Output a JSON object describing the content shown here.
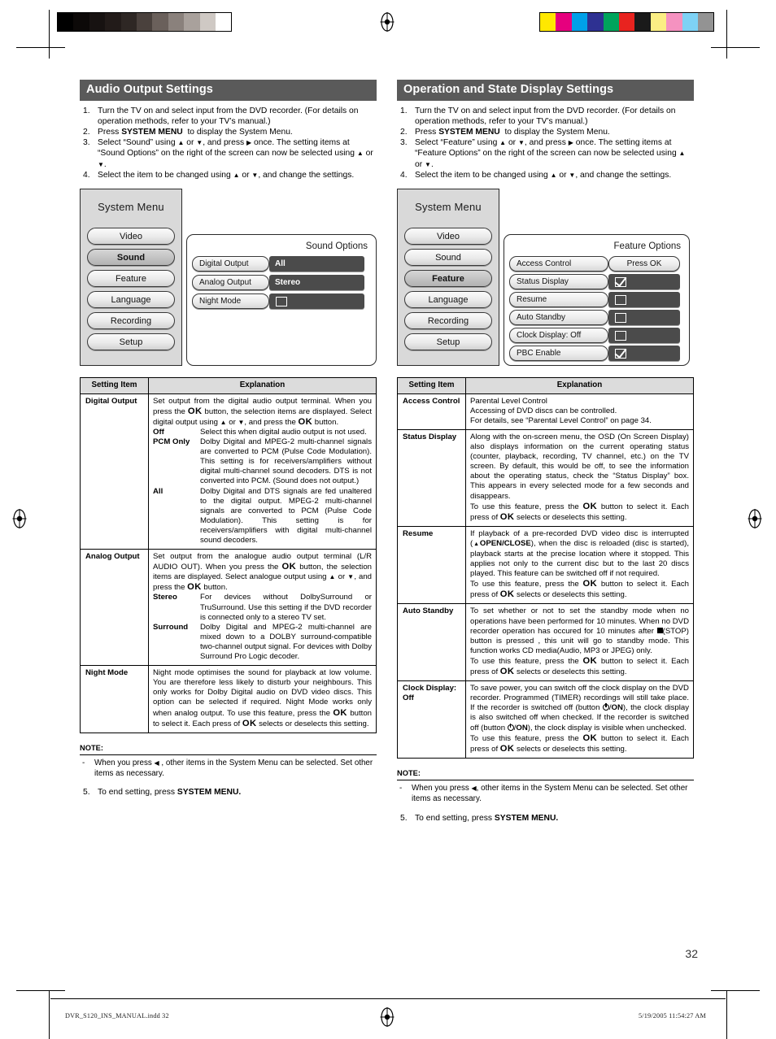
{
  "page": {
    "number": "32",
    "footer_left": "DVR_S120_INS_MANUAL.indd   32",
    "footer_right": "5/19/2005   11:54:27 AM"
  },
  "calibration": {
    "gray_bar": [
      "#000000",
      "#0c0908",
      "#171211",
      "#221b19",
      "#2e2724",
      "#4a413d",
      "#6a605b",
      "#8a817c",
      "#a9a19c",
      "#cfc9c4",
      "#ffffff"
    ],
    "color_bar": [
      "#ffe800",
      "#e6007e",
      "#00a0e9",
      "#2e3192",
      "#00a45c",
      "#e8231f",
      "#1a1a1a",
      "#fbee84",
      "#f592c0",
      "#7ed2f5",
      "#939393"
    ]
  },
  "left": {
    "title": "Audio Output Settings",
    "steps": [
      {
        "num": "1.",
        "html": "Turn the TV on and select input from the DVD recorder. (For details on operation methods, refer to your TV&rsquo;s manual.)"
      },
      {
        "num": "2.",
        "html": "Press <span class=\"b\">SYSTEM MENU</span>&nbsp; to display the System Menu."
      },
      {
        "num": "3.",
        "html": "Select &ldquo;Sound&rdquo; using <span class=\"tri-u\"></span> or <span class=\"tri-d\"></span>, and press <span class=\"tri-r\"></span> once. The setting items at &ldquo;Sound Options&rdquo; on the right of the screen can now be selected using <span class=\"tri-u\"></span> or <span class=\"tri-d\"></span>."
      },
      {
        "num": "4.",
        "html": "Select the item to be changed using <span class=\"tri-u\"></span> or <span class=\"tri-d\"></span>, and change the settings."
      }
    ],
    "mock": {
      "menu_title": "System Menu",
      "menu_items": [
        "Video",
        "Sound",
        "Feature",
        "Language",
        "Recording",
        "Setup"
      ],
      "selected_menu_item": "Sound",
      "options_title": "Sound Options",
      "options": [
        {
          "label": "Digital Output",
          "value": "All",
          "type": "text"
        },
        {
          "label": "Analog Output",
          "value": "Stereo",
          "type": "text"
        },
        {
          "label": "Night Mode",
          "value": "",
          "type": "checkbox",
          "checked": false
        }
      ]
    },
    "table": {
      "headers": [
        "Setting Item",
        "Explanation"
      ],
      "rows": [
        {
          "item": "Digital Output",
          "intro": "Set output from the digital audio output terminal. When you press the <span class=\"ok\">OK</span> button, the selection items are displayed. Select digital output using <span class=\"tri-u\"></span> or <span class=\"tri-d\"></span>, and press the <span class=\"ok\">OK</span> button.",
          "subs": [
            {
              "k": "Off",
              "v": "Select this when digital audio output is not used."
            },
            {
              "k": "PCM Only",
              "v": "Dolby Digital and MPEG-2 multi-channel signals are converted to PCM (Pulse Code Modulation). This setting is for receivers/amplifiers without digital multi-channel sound decoders. DTS is not converted into PCM. (Sound does not output.)"
            },
            {
              "k": "All",
              "v": "Dolby Digital and DTS signals are fed unaltered to the digital output. MPEG-2 multi-channel signals are converted to PCM (Pulse Code Modulation). This setting is for receivers/amplifiers with digital multi-channel sound decoders."
            }
          ]
        },
        {
          "item": "Analog Output",
          "intro": "Set output from the analogue audio output terminal (L/R AUDIO OUT). When you press the <span class=\"ok\">OK</span> button, the selection items are displayed. Select analogue output using <span class=\"tri-u\"></span> or <span class=\"tri-d\"></span>, and press the <span class=\"ok\">OK</span> button.",
          "subs": [
            {
              "k": "Stereo",
              "v": "For devices without DolbySurround or TruSurround. Use this setting if the DVD recorder is connected only to a stereo TV set."
            },
            {
              "k": "Surround",
              "v": "Dolby Digital and MPEG-2 multi-channel are mixed down to a DOLBY surround-compatible two-channel output signal. For devices with Dolby Surround Pro Logic decoder."
            }
          ]
        },
        {
          "item": "Night Mode",
          "intro": "Night mode optimises the sound for playback at low volume. You are therefore less likely to disturb your neighbours. This only works for Dolby Digital audio on DVD video discs. This option can be selected if required. Night Mode works only when analog output. To use this feature, press the <span class=\"ok\">OK</span> button to select it. Each press of <span class=\"ok\">OK</span> selects or deselects this setting.",
          "subs": []
        }
      ]
    },
    "note": {
      "header": "NOTE:",
      "marker": "-",
      "text": "When you press <span class=\"tri-l\"></span> , other items in the System Menu can be selected. Set other items as necessary.",
      "end_num": "5.",
      "end_text": "To end setting, press <span class=\"b\">SYSTEM MENU.</span>"
    }
  },
  "right": {
    "title": "Operation and State Display Settings",
    "steps": [
      {
        "num": "1.",
        "html": "Turn the TV on and select input from the DVD recorder. (For details on operation methods, refer to your TV&rsquo;s manual.)"
      },
      {
        "num": "2.",
        "html": "Press <span class=\"b\">SYSTEM MENU</span>&nbsp; to display the System Menu."
      },
      {
        "num": "3.",
        "html": "Select &ldquo;Feature&rdquo; using <span class=\"tri-u\"></span> or <span class=\"tri-d\"></span>, and press <span class=\"tri-r\"></span> once. The setting items at &ldquo;Feature Options&rdquo; on the right of the screen can now be selected using <span class=\"tri-u\"></span> or <span class=\"tri-d\"></span>."
      },
      {
        "num": "4.",
        "html": "Select the item to be changed using <span class=\"tri-u\"></span> or <span class=\"tri-d\"></span>, and change the settings."
      }
    ],
    "mock": {
      "menu_title": "System Menu",
      "menu_items": [
        "Video",
        "Sound",
        "Feature",
        "Language",
        "Recording",
        "Setup"
      ],
      "selected_menu_item": "Feature",
      "options_title": "Feature Options",
      "options": [
        {
          "label": "Access Control",
          "value": "Press OK",
          "type": "button"
        },
        {
          "label": "Status Display",
          "value": "",
          "type": "checkbox",
          "checked": true
        },
        {
          "label": "Resume",
          "value": "",
          "type": "checkbox",
          "checked": false
        },
        {
          "label": "Auto Standby",
          "value": "",
          "type": "checkbox",
          "checked": false
        },
        {
          "label": "Clock Display: Off",
          "value": "",
          "type": "checkbox",
          "checked": false
        },
        {
          "label": "PBC Enable",
          "value": "",
          "type": "checkbox",
          "checked": true
        }
      ]
    },
    "table": {
      "headers": [
        "Setting Item",
        "Explanation"
      ],
      "rows": [
        {
          "item": "Access Control",
          "lines": [
            "Parental Level Control",
            "Accessing of DVD discs can be controlled.",
            "For details, see &ldquo;Parental Level Control&rdquo; on page 34."
          ]
        },
        {
          "item": "Status Display",
          "intro": "Along with the on-screen menu, the OSD (On Screen Display) also displays information on the current operating status (counter, playback, recording, TV channel, etc.) on the TV screen. By default, this would be off, to see the information about the operating status, check the &ldquo;Status Display&rdquo; box. This appears in every selected mode for a few seconds and disappears.",
          "tail": "To use this feature, press the <span class=\"ok\">OK</span> button to select it. Each press of <span class=\"ok\">OK</span> selects or deselects this setting."
        },
        {
          "item": "Resume",
          "intro": "If playback of a pre-recorded DVD video disc is interrupted (<span class=\"eject\"></span><span class=\"b\">OPEN/CLOSE</span>), when the disc is reloaded (disc is started), playback starts at the precise location where it stopped. This applies not only to the current disc but to the last 20 discs played. This feature can be switched off if not required.",
          "tail": "To use this feature, press the <span class=\"ok\">OK</span> button to select it. Each press of <span class=\"ok\">OK</span> selects or deselects this setting."
        },
        {
          "item": "Auto Standby",
          "intro": "To set whether or not to set the standby mode when no operations have been performed for 10 minutes. When no DVD recorder operation has occured for 10 minutes after <span class=\"stopsq\"></span>(STOP) button is pressed , this unit will  go to standby mode. This function works CD media(Audio, MP3 or JPEG) only.",
          "tail": "To use this feature, press the <span class=\"ok\">OK</span> button to select it. Each press of <span class=\"ok\">OK</span> selects or deselects this setting."
        },
        {
          "item": "Clock Display: Off",
          "intro": "To save power, you can switch off the clock display on the DVD recorder. Programmed (TIMER) recordings will still take place. If the recorder is switched off (button <span class=\"pwr\"></span>/<span class=\"b\">ON</span>), the clock display is also switched off when checked. If the recorder is switched off (button <span class=\"pwr\"></span>/<span class=\"b\">ON</span>), the clock display is visible when unchecked.",
          "tail": "To use this feature, press the <span class=\"ok\">OK</span> button to select it. Each press of <span class=\"ok\">OK</span> selects or deselects this setting."
        }
      ]
    },
    "note": {
      "header": "NOTE:",
      "marker": "-",
      "text": "When you press <span class=\"tri-l\"></span>, other items in the System Menu can be selected. Set other items as necessary.",
      "end_num": "5.",
      "end_text": "To end setting, press <span class=\"b\">SYSTEM MENU.</span>"
    }
  }
}
